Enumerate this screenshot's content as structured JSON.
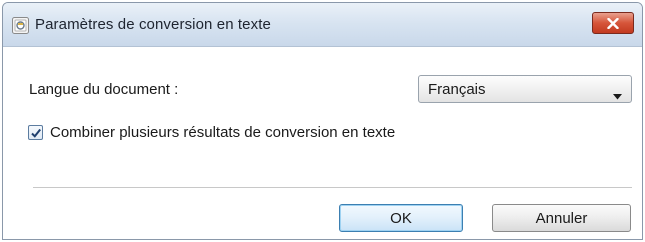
{
  "dialog": {
    "title": "Paramètres de conversion en texte",
    "app_icon": "app-icon",
    "close_icon": "close-icon"
  },
  "language": {
    "label": "Langue du document :",
    "selected": "Français",
    "arrow_icon": "chevron-down-icon"
  },
  "combine": {
    "label": "Combiner plusieurs résultats de conversion en texte",
    "checked": true
  },
  "buttons": {
    "ok": "OK",
    "cancel": "Annuler"
  },
  "colors": {
    "close_button": "#c94a2e",
    "default_button_border": "#3c7fb1"
  }
}
